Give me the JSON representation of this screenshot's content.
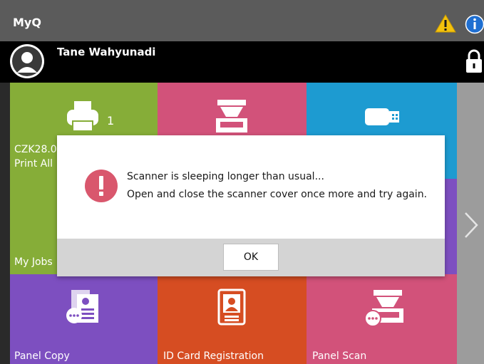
{
  "app": {
    "title": "MyQ"
  },
  "header_icons": [
    "warning-icon",
    "info-icon"
  ],
  "user": {
    "name": "Tane Wahyunadi"
  },
  "colors": {
    "topbar": "#5b5b5b",
    "userbar": "#000000",
    "green": "#86ad38",
    "pink": "#d2527a",
    "blue": "#1d9bd1",
    "purple": "#7d4fc0",
    "orange": "#d64d22",
    "error": "#d9576d"
  },
  "tiles": [
    {
      "name": "print-all",
      "line1": "CZK28.00",
      "line2": "Print All",
      "count": "1",
      "icon": "printer-icon"
    },
    {
      "name": "scan",
      "label": "",
      "icon": "scanner-icon"
    },
    {
      "name": "usb",
      "label": "",
      "icon": "usb-icon"
    },
    {
      "name": "my-jobs",
      "label": "My Jobs"
    },
    {
      "name": "panel-copy",
      "label": "Panel Copy",
      "icon": "copy-icon"
    },
    {
      "name": "id-card-registration",
      "label": "ID Card Registration",
      "icon": "id-card-icon"
    },
    {
      "name": "panel-scan",
      "label": "Panel Scan",
      "icon": "panel-scan-icon"
    }
  ],
  "dialog": {
    "line1": "Scanner is sleeping longer than usual...",
    "line2": "Open and close the scanner cover once more and try again.",
    "ok_label": "OK"
  }
}
